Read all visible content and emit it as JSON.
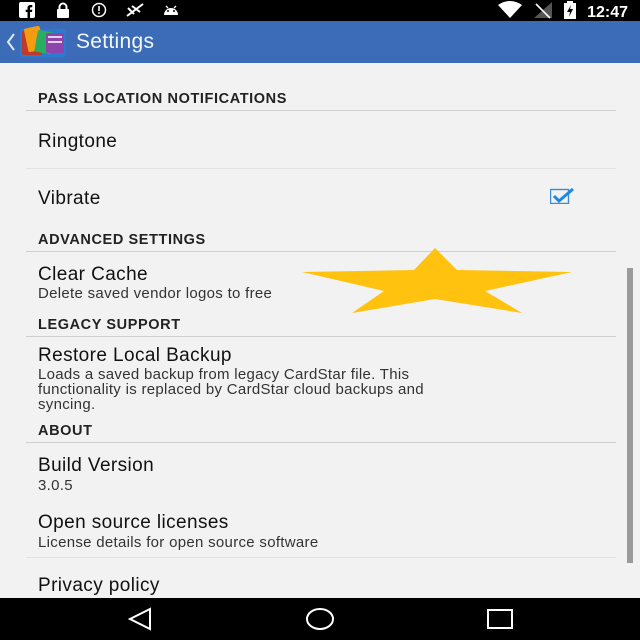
{
  "status_bar": {
    "time": "12:47",
    "icons": [
      "facebook-icon",
      "lock-icon",
      "sync-icon",
      "signal-blocked-icon",
      "android-debug-icon"
    ],
    "right_icons": [
      "wifi-icon",
      "no-signal-icon",
      "battery-charging-icon"
    ]
  },
  "app_bar": {
    "title": "Settings"
  },
  "sections": {
    "pass": {
      "header": "PASS LOCATION NOTIFICATIONS",
      "ringtone": {
        "title": "Ringtone"
      },
      "vibrate": {
        "title": "Vibrate",
        "checked": true
      }
    },
    "advanced": {
      "header": "ADVANCED SETTINGS",
      "clear_cache": {
        "title": "Clear Cache",
        "summary": "Delete saved vendor logos to free"
      }
    },
    "legacy": {
      "header": "LEGACY SUPPORT",
      "restore": {
        "title": "Restore Local Backup",
        "summary_line1": "Loads a saved backup from legacy CardStar file. This",
        "summary_line2": "functionality is replaced by CardStar cloud backups and",
        "summary_line3": "syncing."
      }
    },
    "about": {
      "header": "ABOUT",
      "build": {
        "title": "Build Version",
        "summary": "3.0.5"
      },
      "licenses": {
        "title": "Open source licenses",
        "summary": "License details for open source software"
      },
      "privacy": {
        "title": "Privacy policy"
      }
    }
  },
  "colors": {
    "app_bar": "#3c6cb7",
    "checkbox": "#1e88e5",
    "star": "#ffc20e",
    "background": "#f2f2f2"
  },
  "nav_bar": {
    "icons": [
      "back-icon",
      "home-icon",
      "recents-icon"
    ]
  }
}
